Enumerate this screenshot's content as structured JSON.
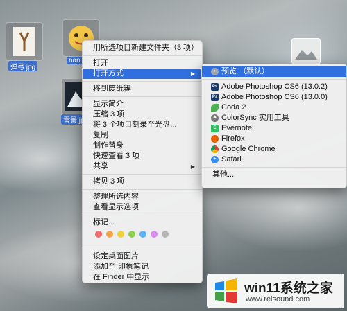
{
  "desktop": {
    "files": [
      {
        "label": "弹弓.jpg"
      },
      {
        "label": "nan..."
      },
      {
        "label": "雪景.jp..."
      }
    ]
  },
  "context_menu": {
    "items": [
      {
        "label": "用所选项目新建文件夹（3 项）"
      },
      {
        "label": "打开"
      },
      {
        "label": "打开方式"
      },
      {
        "label": "移到废纸篓"
      },
      {
        "label": "显示简介"
      },
      {
        "label": "压缩 3 项"
      },
      {
        "label": "将 3 个项目刻录至光盘..."
      },
      {
        "label": "复制"
      },
      {
        "label": "制作替身"
      },
      {
        "label": "快速查看 3 项"
      },
      {
        "label": "共享"
      },
      {
        "label": "拷贝 3 项"
      },
      {
        "label": "整理所选内容"
      },
      {
        "label": "查看显示选项"
      },
      {
        "label": "标记..."
      },
      {
        "label": "设定桌面图片"
      },
      {
        "label": "添加至 印象笔记"
      },
      {
        "label": "在 Finder 中显示"
      }
    ],
    "tag_colors": [
      "#f26d6d",
      "#f7a44a",
      "#f2d23c",
      "#8fd14f",
      "#5ab3f2",
      "#d88ef0",
      "#b5b5b5"
    ]
  },
  "open_with_menu": {
    "items": [
      {
        "label": "预览 （默认）",
        "icon": "preview-icon"
      },
      {
        "label": "Adobe Photoshop CS6 (13.0.2)",
        "icon": "photoshop-icon"
      },
      {
        "label": "Adobe Photoshop CS6 (13.0.0)",
        "icon": "photoshop-icon"
      },
      {
        "label": "Coda 2",
        "icon": "coda-icon"
      },
      {
        "label": "ColorSync 实用工具",
        "icon": "colorsync-icon"
      },
      {
        "label": "Evernote",
        "icon": "evernote-icon"
      },
      {
        "label": "Firefox",
        "icon": "firefox-icon"
      },
      {
        "label": "Google Chrome",
        "icon": "chrome-icon"
      },
      {
        "label": "Safari",
        "icon": "safari-icon"
      },
      {
        "label": "其他..."
      }
    ]
  },
  "watermark": {
    "brand": "win11系统之家",
    "url": "www.relsound.com"
  }
}
